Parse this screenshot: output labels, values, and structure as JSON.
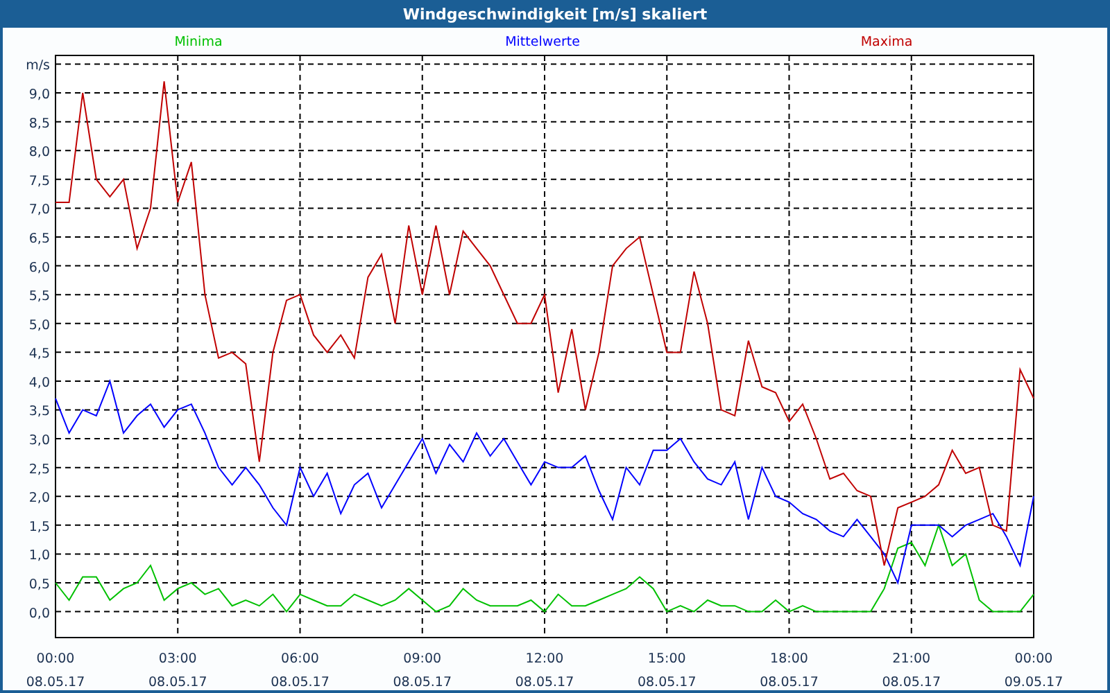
{
  "window": {
    "title": "Windgeschwindigkeit [m/s] skaliert"
  },
  "chart": {
    "chart_data": {
      "type": "line",
      "ylabel": "m/s",
      "grid": true,
      "ylim": [
        -0.45,
        9.65
      ],
      "categories": [
        "00:00 08.05.17",
        null,
        null,
        null,
        null,
        null,
        null,
        null,
        null,
        "03:00 08.05.17",
        null,
        null,
        null,
        null,
        null,
        null,
        null,
        null,
        "06:00 08.05.17",
        null,
        null,
        null,
        null,
        null,
        null,
        null,
        null,
        "09:00 08.05.17",
        null,
        null,
        null,
        null,
        null,
        null,
        null,
        null,
        "12:00 08.05.17",
        null,
        null,
        null,
        null,
        null,
        null,
        null,
        null,
        "15:00 08.05.17",
        null,
        null,
        null,
        null,
        null,
        null,
        null,
        null,
        "18:00 08.05.17",
        null,
        null,
        null,
        null,
        null,
        null,
        null,
        null,
        "21:00 08.05.17",
        null,
        null,
        null,
        null,
        null,
        null,
        null,
        null,
        "00:00 09.05.17"
      ],
      "yticks": [
        {
          "value": 0,
          "label": "0,0"
        },
        {
          "value": 0.5,
          "label": "0,5"
        },
        {
          "value": 1,
          "label": "1,0"
        },
        {
          "value": 1.5,
          "label": "1,5"
        },
        {
          "value": 2,
          "label": "2,0"
        },
        {
          "value": 2.5,
          "label": "2,5"
        },
        {
          "value": 3,
          "label": "3,0"
        },
        {
          "value": 3.5,
          "label": "3,5"
        },
        {
          "value": 4,
          "label": "4,0"
        },
        {
          "value": 4.5,
          "label": "4,5"
        },
        {
          "value": 5,
          "label": "5,0"
        },
        {
          "value": 5.5,
          "label": "5,5"
        },
        {
          "value": 6,
          "label": "6,0"
        },
        {
          "value": 6.5,
          "label": "6,5"
        },
        {
          "value": 7,
          "label": "7,0"
        },
        {
          "value": 7.5,
          "label": "7,5"
        },
        {
          "value": 8,
          "label": "8,0"
        },
        {
          "value": 8.5,
          "label": "8,5"
        },
        {
          "value": 9,
          "label": "9,0"
        }
      ],
      "series": [
        {
          "name": "Minima",
          "color": "#00c000",
          "values": [
            0.5,
            0.2,
            0.6,
            0.6,
            0.2,
            0.4,
            0.5,
            0.8,
            0.2,
            0.4,
            0.5,
            0.3,
            0.4,
            0.1,
            0.2,
            0.1,
            0.3,
            0.0,
            0.3,
            0.2,
            0.1,
            0.1,
            0.3,
            0.2,
            0.1,
            0.2,
            0.4,
            0.2,
            0.0,
            0.1,
            0.4,
            0.2,
            0.1,
            0.1,
            0.1,
            0.2,
            0.0,
            0.3,
            0.1,
            0.1,
            0.2,
            0.3,
            0.4,
            0.6,
            0.4,
            0.0,
            0.1,
            0.0,
            0.2,
            0.1,
            0.1,
            0.0,
            0.0,
            0.2,
            0.0,
            0.1,
            0.0,
            0.0,
            0.0,
            0.0,
            0.0,
            0.4,
            1.1,
            1.2,
            0.8,
            1.5,
            0.8,
            1.0,
            0.2,
            0.0,
            0.0,
            0.0,
            0.3
          ]
        },
        {
          "name": "Mittelwerte",
          "color": "#0000ff",
          "values": [
            3.7,
            3.1,
            3.5,
            3.4,
            4.0,
            3.1,
            3.4,
            3.6,
            3.2,
            3.5,
            3.6,
            3.1,
            2.5,
            2.2,
            2.5,
            2.2,
            1.8,
            1.5,
            2.5,
            2.0,
            2.4,
            1.7,
            2.2,
            2.4,
            1.8,
            2.2,
            2.6,
            3.0,
            2.4,
            2.9,
            2.6,
            3.1,
            2.7,
            3.0,
            2.6,
            2.2,
            2.6,
            2.5,
            2.5,
            2.7,
            2.1,
            1.6,
            2.5,
            2.2,
            2.8,
            2.8,
            3.0,
            2.6,
            2.3,
            2.2,
            2.6,
            1.6,
            2.5,
            2.0,
            1.9,
            1.7,
            1.6,
            1.4,
            1.3,
            1.6,
            1.3,
            1.0,
            0.5,
            1.5,
            1.5,
            1.5,
            1.3,
            1.5,
            1.6,
            1.7,
            1.3,
            0.8,
            2.0
          ]
        },
        {
          "name": "Maxima",
          "color": "#c00000",
          "values": [
            7.1,
            7.1,
            9.0,
            7.5,
            7.2,
            7.5,
            6.3,
            7.0,
            9.2,
            7.1,
            7.8,
            5.5,
            4.4,
            4.5,
            4.3,
            2.6,
            4.5,
            5.4,
            5.5,
            4.8,
            4.5,
            4.8,
            4.4,
            5.8,
            6.2,
            5.0,
            6.7,
            5.5,
            6.7,
            5.5,
            6.6,
            6.3,
            6.0,
            5.5,
            5.0,
            5.0,
            5.5,
            3.8,
            4.9,
            3.5,
            4.5,
            6.0,
            6.3,
            6.5,
            5.5,
            4.5,
            4.5,
            5.9,
            5.0,
            3.5,
            3.4,
            4.7,
            3.9,
            3.8,
            3.3,
            3.6,
            3.0,
            2.3,
            2.4,
            2.1,
            2.0,
            0.8,
            1.8,
            1.9,
            2.0,
            2.2,
            2.8,
            2.4,
            2.5,
            1.5,
            1.4,
            4.2,
            3.7
          ]
        }
      ]
    }
  }
}
